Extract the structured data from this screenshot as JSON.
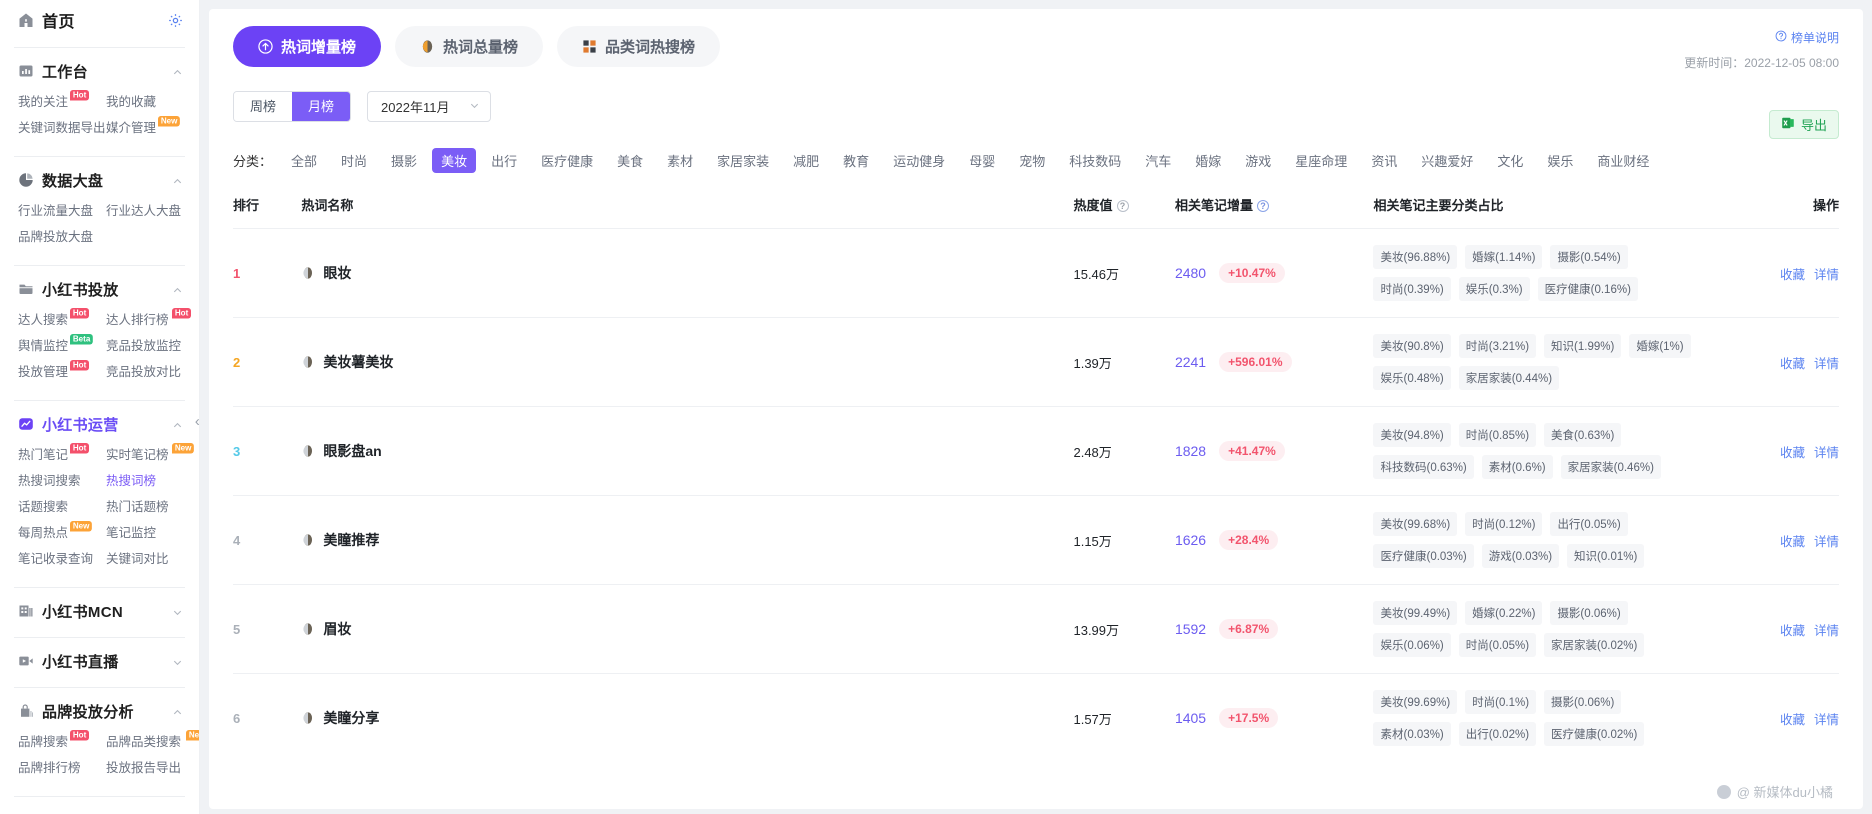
{
  "sidebar": {
    "home": {
      "label": "首页",
      "icon": "home-icon",
      "settings_icon": "gear-icon"
    },
    "groups": [
      {
        "title": "工作台",
        "icon": "workbench-icon",
        "expanded": true,
        "links": [
          {
            "label": "我的关注",
            "tag": "Hot",
            "tag_type": "hot"
          },
          {
            "label": "我的收藏",
            "tag": "",
            "tag_type": ""
          },
          {
            "label": "关键词数据导出",
            "tag": "",
            "tag_type": ""
          },
          {
            "label": "媒介管理",
            "tag": "New",
            "tag_type": "new"
          }
        ]
      },
      {
        "title": "数据大盘",
        "icon": "pie-chart-icon",
        "expanded": true,
        "links": [
          {
            "label": "行业流量大盘",
            "tag": "",
            "tag_type": ""
          },
          {
            "label": "行业达人大盘",
            "tag": "",
            "tag_type": ""
          },
          {
            "label": "品牌投放大盘",
            "tag": "",
            "tag_type": ""
          }
        ]
      },
      {
        "title": "小红书投放",
        "icon": "folder-icon",
        "expanded": true,
        "links": [
          {
            "label": "达人搜索",
            "tag": "Hot",
            "tag_type": "hot"
          },
          {
            "label": "达人排行榜",
            "tag": "Hot",
            "tag_type": "hot"
          },
          {
            "label": "舆情监控",
            "tag": "Beta",
            "tag_type": "beta"
          },
          {
            "label": "竞品投放监控",
            "tag": "",
            "tag_type": ""
          },
          {
            "label": "投放管理",
            "tag": "Hot",
            "tag_type": "hot"
          },
          {
            "label": "竞品投放对比",
            "tag": "",
            "tag_type": ""
          }
        ]
      },
      {
        "title": "小红书运营",
        "icon": "trend-icon",
        "expanded": true,
        "accent": true,
        "links": [
          {
            "label": "热门笔记",
            "tag": "Hot",
            "tag_type": "hot"
          },
          {
            "label": "实时笔记榜",
            "tag": "New",
            "tag_type": "new"
          },
          {
            "label": "热搜词搜索",
            "tag": "",
            "tag_type": ""
          },
          {
            "label": "热搜词榜",
            "tag": "",
            "tag_type": "",
            "active": true
          },
          {
            "label": "话题搜索",
            "tag": "",
            "tag_type": ""
          },
          {
            "label": "热门话题榜",
            "tag": "",
            "tag_type": ""
          },
          {
            "label": "每周热点",
            "tag": "New",
            "tag_type": "new"
          },
          {
            "label": "笔记监控",
            "tag": "",
            "tag_type": ""
          },
          {
            "label": "笔记收录查询",
            "tag": "",
            "tag_type": ""
          },
          {
            "label": "关键词对比",
            "tag": "",
            "tag_type": ""
          }
        ]
      },
      {
        "title": "小红书MCN",
        "icon": "building-icon",
        "expanded": false,
        "links": []
      },
      {
        "title": "小红书直播",
        "icon": "video-icon",
        "expanded": false,
        "links": []
      },
      {
        "title": "品牌投放分析",
        "icon": "bag-icon",
        "expanded": true,
        "links": [
          {
            "label": "品牌搜索",
            "tag": "Hot",
            "tag_type": "hot"
          },
          {
            "label": "品牌品类搜索",
            "tag": "New",
            "tag_type": "new"
          },
          {
            "label": "品牌排行榜",
            "tag": "",
            "tag_type": ""
          },
          {
            "label": "投放报告导出",
            "tag": "",
            "tag_type": ""
          }
        ]
      }
    ],
    "collapse_icon": "collapse-sidebar-icon"
  },
  "header": {
    "tabs": [
      {
        "label": "热词增量榜",
        "icon": "arrow-up-circle-icon",
        "active": true
      },
      {
        "label": "热词总量榜",
        "icon": "droplet-icon",
        "active": false
      },
      {
        "label": "品类词热搜榜",
        "icon": "grid-icon",
        "active": false
      }
    ],
    "rank_help": "榜单说明",
    "rank_help_icon": "question-circle-icon",
    "update_time": "更新时间：2022-12-05 08:00",
    "export_label": "导出",
    "export_icon": "excel-icon"
  },
  "filters": {
    "period": {
      "options": [
        "周榜",
        "月榜"
      ],
      "selected": "月榜"
    },
    "date": {
      "value": "2022年11月",
      "caret_icon": "chevron-down-icon"
    },
    "category_label": "分类：",
    "categories": [
      "全部",
      "时尚",
      "摄影",
      "美妆",
      "出行",
      "医疗健康",
      "美食",
      "素材",
      "家居家装",
      "减肥",
      "教育",
      "运动健身",
      "母婴",
      "宠物",
      "科技数码",
      "汽车",
      "婚嫁",
      "游戏",
      "星座命理",
      "资讯",
      "兴趣爱好",
      "文化",
      "娱乐",
      "商业财经"
    ],
    "selected_category": "美妆"
  },
  "table": {
    "columns": {
      "rank": "排行",
      "name": "热词名称",
      "heat": "热度值",
      "delta": "相关笔记增量",
      "cats": "相关笔记主要分类占比",
      "ops": "操作"
    },
    "ops": [
      "收藏",
      "详情"
    ],
    "rows": [
      {
        "rank": "1",
        "keyword": "眼妆",
        "keyword_icon": "droplet-icon",
        "heat": "15.46万",
        "delta_num": "2480",
        "delta_pct": "+10.47%",
        "chips": [
          "美妆(96.88%)",
          "婚嫁(1.14%)",
          "摄影(0.54%)",
          "时尚(0.39%)",
          "娱乐(0.3%)",
          "医疗健康(0.16%)"
        ]
      },
      {
        "rank": "2",
        "keyword": "美妆薯美妆",
        "keyword_icon": "droplet-icon",
        "heat": "1.39万",
        "delta_num": "2241",
        "delta_pct": "+596.01%",
        "chips": [
          "美妆(90.8%)",
          "时尚(3.21%)",
          "知识(1.99%)",
          "婚嫁(1%)",
          "娱乐(0.48%)",
          "家居家装(0.44%)"
        ]
      },
      {
        "rank": "3",
        "keyword": "眼影盘an",
        "keyword_icon": "droplet-icon",
        "heat": "2.48万",
        "delta_num": "1828",
        "delta_pct": "+41.47%",
        "chips": [
          "美妆(94.8%)",
          "时尚(0.85%)",
          "美食(0.63%)",
          "科技数码(0.63%)",
          "素材(0.6%)",
          "家居家装(0.46%)"
        ]
      },
      {
        "rank": "4",
        "keyword": "美瞳推荐",
        "keyword_icon": "droplet-icon",
        "heat": "1.15万",
        "delta_num": "1626",
        "delta_pct": "+28.4%",
        "chips": [
          "美妆(99.68%)",
          "时尚(0.12%)",
          "出行(0.05%)",
          "医疗健康(0.03%)",
          "游戏(0.03%)",
          "知识(0.01%)"
        ]
      },
      {
        "rank": "5",
        "keyword": "眉妆",
        "keyword_icon": "droplet-icon",
        "heat": "13.99万",
        "delta_num": "1592",
        "delta_pct": "+6.87%",
        "chips": [
          "美妆(99.49%)",
          "婚嫁(0.22%)",
          "摄影(0.06%)",
          "娱乐(0.06%)",
          "时尚(0.05%)",
          "家居家装(0.02%)"
        ]
      },
      {
        "rank": "6",
        "keyword": "美瞳分享",
        "keyword_icon": "droplet-icon",
        "heat": "1.57万",
        "delta_num": "1405",
        "delta_pct": "+17.5%",
        "chips": [
          "美妆(99.69%)",
          "时尚(0.1%)",
          "摄影(0.06%)",
          "素材(0.03%)",
          "出行(0.02%)",
          "医疗健康(0.02%)"
        ]
      }
    ]
  },
  "watermark": {
    "text": "@ 新媒体du小橘",
    "logo": "watermark-logo-icon"
  },
  "colors": {
    "primary": "#6c42f5",
    "accent": "#7b5df6",
    "danger": "#f2546d",
    "link": "#5b83f0",
    "success": "#22a355"
  }
}
